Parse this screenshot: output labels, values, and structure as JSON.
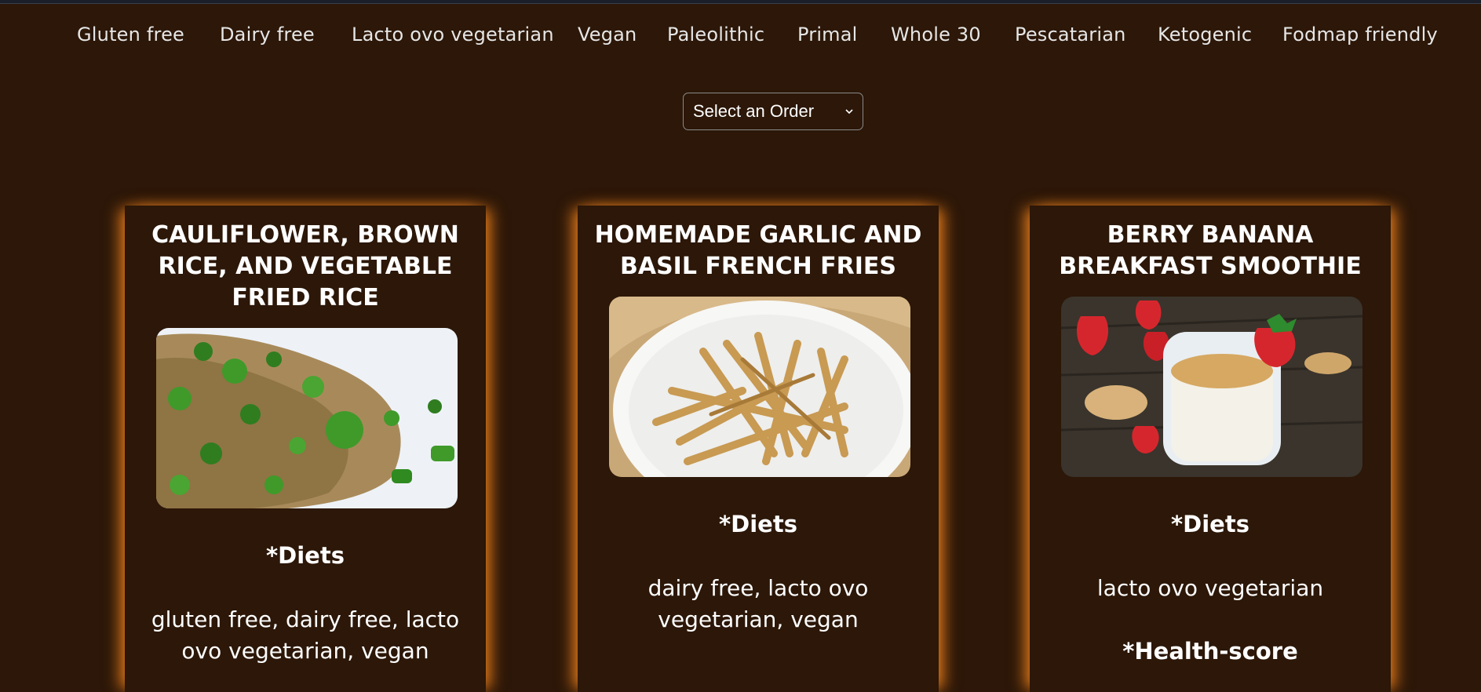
{
  "filters": [
    "Gluten free",
    "Dairy free",
    "Lacto ovo vegetarian",
    "Vegan",
    "Paleolithic",
    "Primal",
    "Whole 30",
    "Pescatarian",
    "Ketogenic",
    "Fodmap friendly"
  ],
  "order_select": {
    "selected": "Select an Order"
  },
  "cards": [
    {
      "title": "CAULIFLOWER, BROWN RICE, AND VEGETABLE FRIED RICE",
      "diets_label": "*Diets",
      "diets": "gluten free, dairy free, lacto ovo vegetarian, vegan"
    },
    {
      "title": "HOMEMADE GARLIC AND BASIL FRENCH FRIES",
      "diets_label": "*Diets",
      "diets": "dairy free, lacto ovo vegetarian, vegan"
    },
    {
      "title": "BERRY BANANA BREAKFAST SMOOTHIE",
      "diets_label": "*Diets",
      "diets": "lacto ovo vegetarian",
      "health_label": "*Health-score"
    }
  ],
  "colors": {
    "background": "#2c1708",
    "glow": "#e07a1c",
    "text": "#ffffff"
  }
}
